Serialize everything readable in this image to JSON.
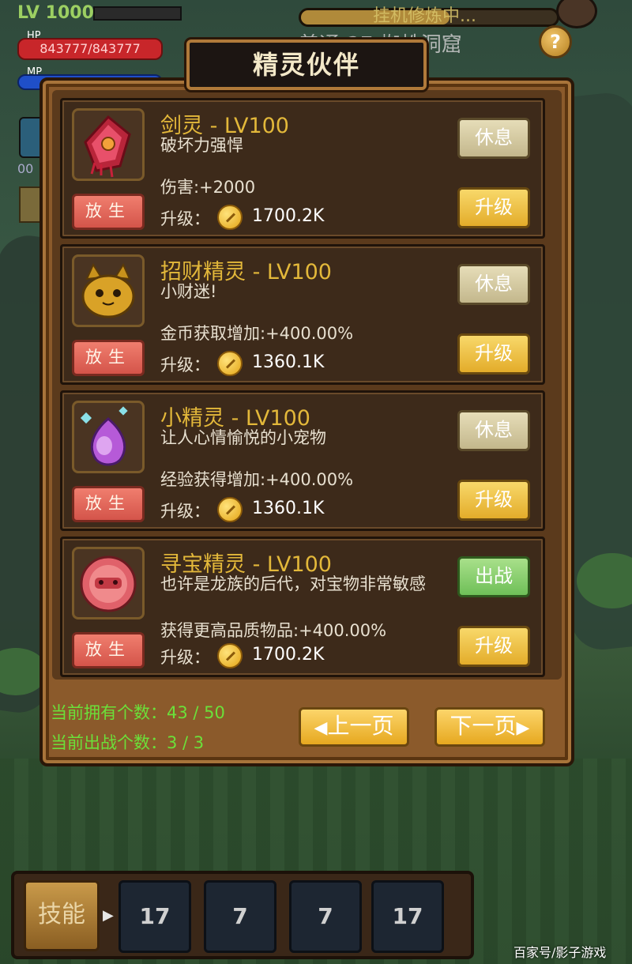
{
  "hud": {
    "level": "LV 1000",
    "hp_label": "HP",
    "hp_value": "843777/843777",
    "mp_label": "MP",
    "skill_count": "00",
    "idle_status": "挂机修炼中...",
    "area": "普通-27 蜘蛛洞窟"
  },
  "help_label": "?",
  "panel": {
    "title": "精灵伙伴",
    "cards": [
      {
        "name": "剑灵 - LV100",
        "desc": "破坏力强悍",
        "stat": "伤害:+2000",
        "upgrade_label": "升级：",
        "upgrade_cost": "1700.2K",
        "release_label": "放生",
        "state_label": "休息",
        "state_active": false,
        "upgrade_btn": "升级"
      },
      {
        "name": "招财精灵 - LV100",
        "desc": "小财迷!",
        "stat": "金币获取增加:+400.00%",
        "upgrade_label": "升级：",
        "upgrade_cost": "1360.1K",
        "release_label": "放生",
        "state_label": "休息",
        "state_active": false,
        "upgrade_btn": "升级"
      },
      {
        "name": "小精灵 - LV100",
        "desc": "让人心情愉悦的小宠物",
        "stat": "经验获得增加:+400.00%",
        "upgrade_label": "升级：",
        "upgrade_cost": "1360.1K",
        "release_label": "放生",
        "state_label": "休息",
        "state_active": false,
        "upgrade_btn": "升级"
      },
      {
        "name": "寻宝精灵 - LV100",
        "desc": "也许是龙族的后代，对宝物非常敏感",
        "stat": "获得更高品质物品:+400.00%",
        "upgrade_label": "升级：",
        "upgrade_cost": "1700.2K",
        "release_label": "放生",
        "state_label": "出战",
        "state_active": true,
        "upgrade_btn": "升级"
      }
    ],
    "owned_count": "当前拥有个数：43 / 50",
    "battle_count": "当前出战个数：3 / 3",
    "prev_page": "上一页",
    "next_page": "下一页"
  },
  "skills": {
    "main_label": "技能",
    "slots": [
      "17",
      "7",
      "7",
      "17"
    ]
  },
  "watermark": "百家号/影子游戏",
  "colors": {
    "gold_text": "#e3b83a",
    "count_green": "#6be03a",
    "release_red": "#d4544a",
    "active_green": "#6fbf58"
  }
}
